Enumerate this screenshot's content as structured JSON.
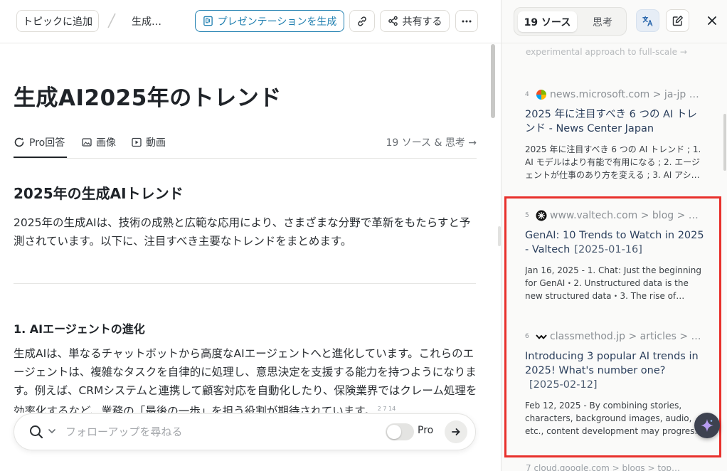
{
  "header": {
    "topic_button": "トピックに追加",
    "breadcrumb": "生成…",
    "present_button": "プレゼンテーションを生成",
    "share_button": "共有する"
  },
  "article": {
    "title": "生成AI2025年のトレンド",
    "tabs": [
      {
        "label": "Pro回答",
        "active": true,
        "icon": "pro-icon"
      },
      {
        "label": "画像",
        "active": false,
        "icon": "image-icon"
      },
      {
        "label": "動画",
        "active": false,
        "icon": "video-icon"
      }
    ],
    "sources_link": "19 ソース & 思考 →",
    "heading": "2025年の生成AIトレンド",
    "intro": "2025年の生成AIは、技術の成熟と広範な応用により、さまざまな分野で革新をもたらすと予測されています。以下に、注目すべき主要なトレンドをまとめます。",
    "section_heading": "1. AIエージェントの進化",
    "section_body": "生成AIは、単なるチャットボットから高度なAIエージェントへと進化しています。これらのエージェントは、複雑なタスクを自律的に処理し、意思決定を支援する能力を持つようになります。例えば、CRMシステムと連携して顧客対応を自動化したり、保険業界ではクレーム処理を効率化するなど、業務の「最後の一歩」を担う役割が期待されています。",
    "citations": "2 7 14"
  },
  "followup": {
    "placeholder": "フォローアップを尋ねる",
    "pro_label": "Pro",
    "pro_enabled": false
  },
  "sidebar": {
    "tabs": [
      {
        "label": "19 ソース",
        "active": true
      },
      {
        "label": "思考",
        "active": false
      }
    ],
    "cut_top": "experimental approach to full-scale →",
    "sources": [
      {
        "num": "4",
        "icon": "microsoft-icon",
        "domain": "news.microsoft.com > ja-jp > f…",
        "title": "2025 年に注目すべき 6 つの AI トレンド - News Center Japan",
        "date": "",
        "snippet": "2025 年に注目すべき 6 つの AI トレンド ; 1. AI モデルはより有能で有用になる ; 2. エージェントが仕事のあり方を変える ; 3. AI アシスタ…"
      },
      {
        "num": "5",
        "icon": "valtech-icon",
        "domain": "www.valtech.com > blog > gen…",
        "title": "GenAI: 10 Trends to Watch in 2025 - Valtech",
        "date": "[2025-01-16]",
        "snippet": "Jan 16, 2025 - 1. Chat: Just the beginning for GenAI・2. Unstructured data is the new structured data・3. The rise of multimodal…"
      },
      {
        "num": "6",
        "icon": "classmethod-icon",
        "domain": "classmethod.jp > articles > 20…",
        "title": "Introducing 3 popular AI trends in 2025! What's number one?",
        "date": "[2025-02-12]",
        "snippet": "Feb 12, 2025 - By combining stories, characters, background images, audio, etc., content development may progress to…"
      }
    ],
    "cut_bottom": "7  cloud.google.com > blogs > top…"
  },
  "colors": {
    "accent": "#1f7fb0",
    "highlight": "#e8302c",
    "source_title": "#2b3f5c"
  }
}
